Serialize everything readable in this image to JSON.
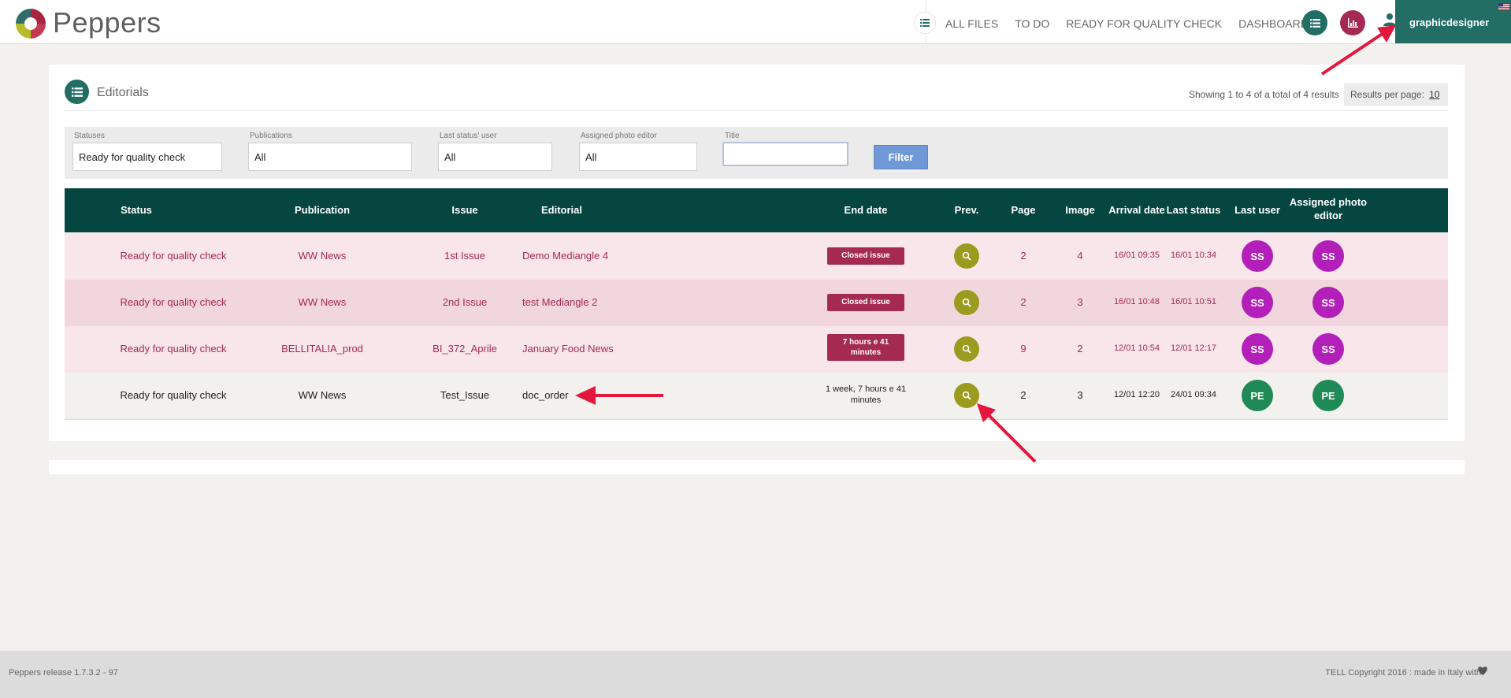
{
  "app": {
    "brand": "Peppers"
  },
  "header": {
    "nav": [
      "ALL FILES",
      "TO DO",
      "READY FOR QUALITY CHECK",
      "DASHBOARD"
    ],
    "user": "graphicdesigner"
  },
  "panel": {
    "title": "Editorials",
    "showing": "Showing 1 to 4 of a total of 4 results",
    "results_per_page_label": "Results per page:",
    "results_per_page_value": "10"
  },
  "filters": {
    "statuses_label": "Statuses",
    "statuses_value": "Ready for quality check",
    "publications_label": "Publications",
    "publications_value": "All",
    "last_status_user_label": "Last status' user",
    "last_status_user_value": "All",
    "assigned_photo_editor_label": "Assigned photo editor",
    "assigned_photo_editor_value": "All",
    "title_label": "Title",
    "title_value": "",
    "filter_button": "Filter"
  },
  "table": {
    "headers": {
      "status": "Status",
      "publication": "Publication",
      "issue": "Issue",
      "editorial": "Editorial",
      "end_date": "End date",
      "prev": "Prev.",
      "page": "Page",
      "image": "Image",
      "arrival_date": "Arrival date",
      "last_status": "Last status",
      "last_user": "Last user",
      "assigned_photo_editor": "Assigned photo editor"
    },
    "rows": [
      {
        "status": "Ready for quality check",
        "publication": "WW News",
        "issue": "1st Issue",
        "editorial": "Demo Mediangle 4",
        "end_date": "Closed issue",
        "page": "2",
        "image": "4",
        "arrival": "16/01 09:35",
        "last_status": "16/01 10:34",
        "last_user": "SS",
        "assigned": "SS"
      },
      {
        "status": "Ready for quality check",
        "publication": "WW News",
        "issue": "2nd Issue",
        "editorial": "test Mediangle 2",
        "end_date": "Closed issue",
        "page": "2",
        "image": "3",
        "arrival": "16/01 10:48",
        "last_status": "16/01 10:51",
        "last_user": "SS",
        "assigned": "SS"
      },
      {
        "status": "Ready for quality check",
        "publication": "BELLITALIA_prod",
        "issue": "BI_372_Aprile",
        "editorial": "January Food News",
        "end_date": "7 hours e 41 minutes",
        "page": "9",
        "image": "2",
        "arrival": "12/01 10:54",
        "last_status": "12/01 12:17",
        "last_user": "SS",
        "assigned": "SS"
      },
      {
        "status": "Ready for quality check",
        "publication": "WW News",
        "issue": "Test_Issue",
        "editorial": "doc_order",
        "end_date": "1 week, 7 hours e 41 minutes",
        "page": "2",
        "image": "3",
        "arrival": "12/01 12:20",
        "last_status": "24/01 09:34",
        "last_user": "PE",
        "assigned": "PE"
      }
    ]
  },
  "footer": {
    "left": "Peppers release 1.7.3.2 - 97",
    "right": "TELL Copyright 2016 : made in Italy with"
  },
  "colors": {
    "teal": "#054640",
    "accent_teal": "#226d64",
    "crimson": "#a52a52",
    "olive": "#9a9b1f",
    "magenta": "#b21fb9",
    "green": "#1f8a55",
    "arrow": "#e3173e"
  },
  "icons": [
    "list-icon",
    "chart-icon",
    "user-icon",
    "search-icon",
    "heart-icon",
    "flag-icon"
  ]
}
